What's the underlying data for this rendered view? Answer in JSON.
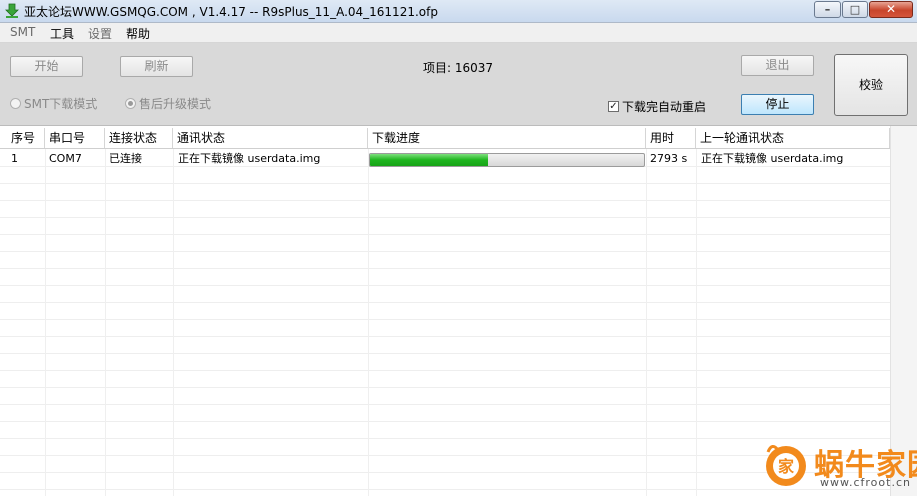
{
  "window": {
    "title": "亚太论坛WWW.GSMQG.COM   , V1.4.17 -- R9sPlus_11_A.04_161121.ofp",
    "minimize_glyph": "–",
    "maximize_glyph": "□",
    "close_glyph": "✕"
  },
  "menu": {
    "items": [
      "SMT",
      "工具",
      "设置",
      "帮助"
    ]
  },
  "toolbar": {
    "start_label": "开始",
    "refresh_label": "刷新",
    "project_label": "项目: 16037",
    "exit_label": "退出",
    "verify_label": "校验",
    "stop_label": "停止",
    "auto_reboot_label": "下载完自动重启",
    "auto_reboot_checked": true,
    "mode_smt_label": "SMT下载模式",
    "mode_aftersale_label": "售后升级模式",
    "selected_mode": "售后升级模式"
  },
  "table": {
    "columns": [
      "序号",
      "串口号",
      "连接状态",
      "通讯状态",
      "下载进度",
      "用时",
      "上一轮通讯状态"
    ],
    "rows": [
      {
        "index": "1",
        "port": "COM7",
        "connection": "已连接",
        "comm_status": "正在下载镜像 userdata.img",
        "progress": 0.43,
        "elapsed": "2793 s",
        "last_status": "正在下载镜像 userdata.img"
      }
    ]
  },
  "watermark": {
    "logo_glyph": "家",
    "text": "蜗牛家园",
    "url": "www.cfroot.cn"
  },
  "colors": {
    "progress_fill": "#1fb51f",
    "watermark_orange": "#f28a1c",
    "stop_button_border": "#3c7fb1"
  }
}
